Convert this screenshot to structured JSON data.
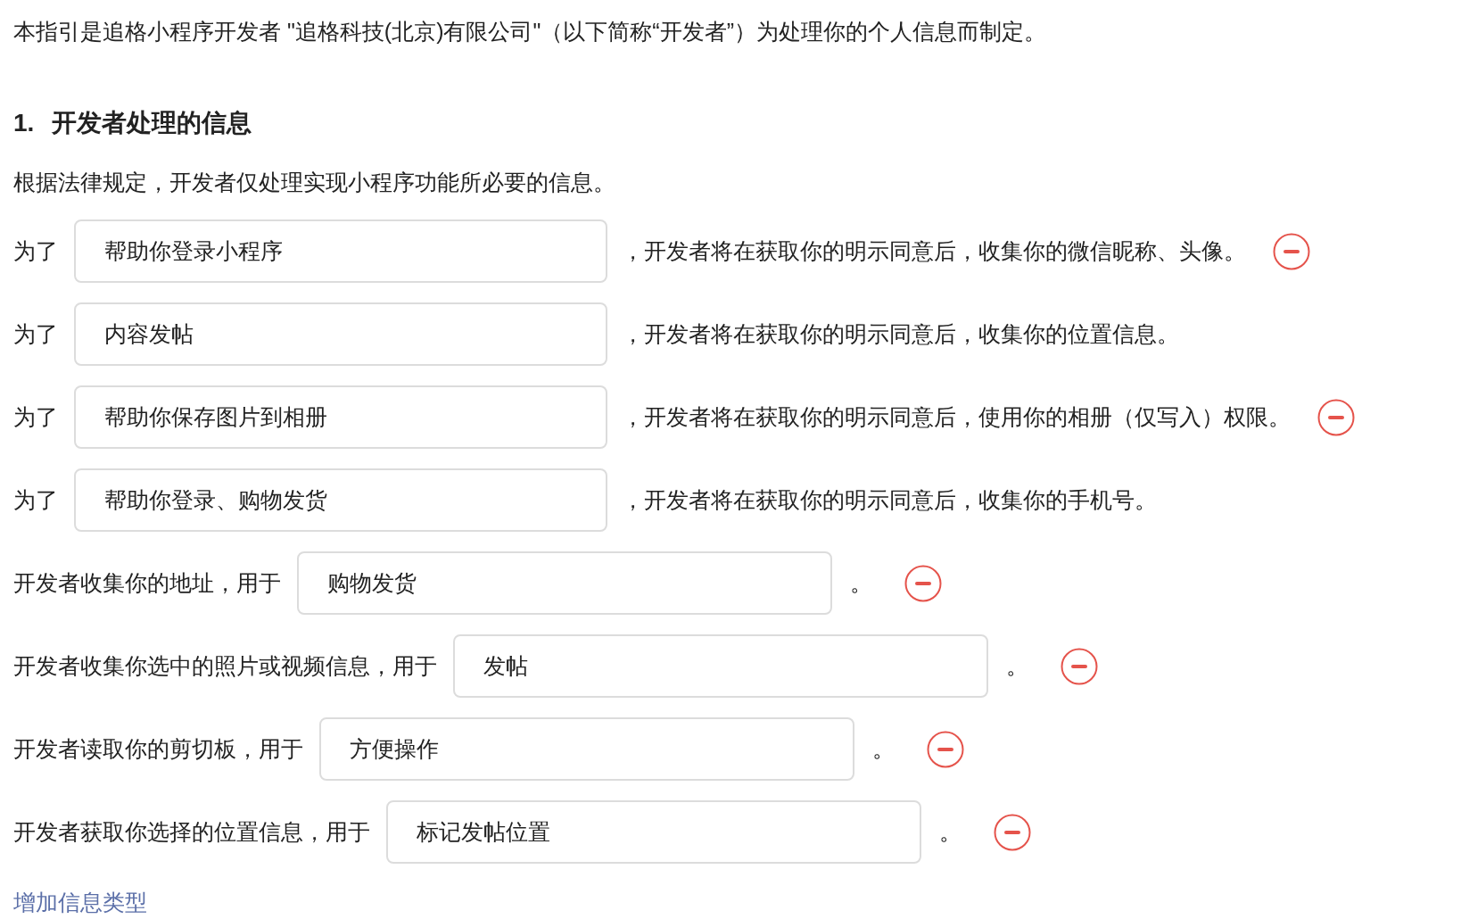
{
  "intro": "本指引是追格小程序开发者 \"追格科技(北京)有限公司\"（以下简称“开发者”）为处理你的个人信息而制定。",
  "section": {
    "number": "1.",
    "title": "开发者处理的信息"
  },
  "lead": "根据法律规定，开发者仅处理实现小程序功能所必要的信息。",
  "rows": [
    {
      "kind": "purpose",
      "prefix": "为了",
      "value": "帮助你登录小程序",
      "suffix": "，开发者将在获取你的明示同意后，收集你的微信昵称、头像。",
      "removable": true
    },
    {
      "kind": "purpose",
      "prefix": "为了",
      "value": "内容发帖",
      "suffix": "，开发者将在获取你的明示同意后，收集你的位置信息。",
      "removable": false
    },
    {
      "kind": "purpose",
      "prefix": "为了",
      "value": "帮助你保存图片到相册",
      "suffix": "，开发者将在获取你的明示同意后，使用你的相册（仅写入）权限。",
      "removable": true
    },
    {
      "kind": "purpose",
      "prefix": "为了",
      "value": "帮助你登录、购物发货",
      "suffix": "，开发者将在获取你的明示同意后，收集你的手机号。",
      "removable": false
    },
    {
      "kind": "usage",
      "prefix": "开发者收集你的地址，用于",
      "value": "购物发货",
      "suffix": "。",
      "removable": true
    },
    {
      "kind": "usage",
      "prefix": "开发者收集你选中的照片或视频信息，用于",
      "value": "发帖",
      "suffix": "。",
      "removable": true
    },
    {
      "kind": "usage",
      "prefix": "开发者读取你的剪切板，用于",
      "value": "方便操作",
      "suffix": "。",
      "removable": true
    },
    {
      "kind": "usage",
      "prefix": "开发者获取你选择的位置信息，用于",
      "value": "标记发帖位置",
      "suffix": "。",
      "removable": true
    }
  ],
  "add_link": "增加信息类型"
}
